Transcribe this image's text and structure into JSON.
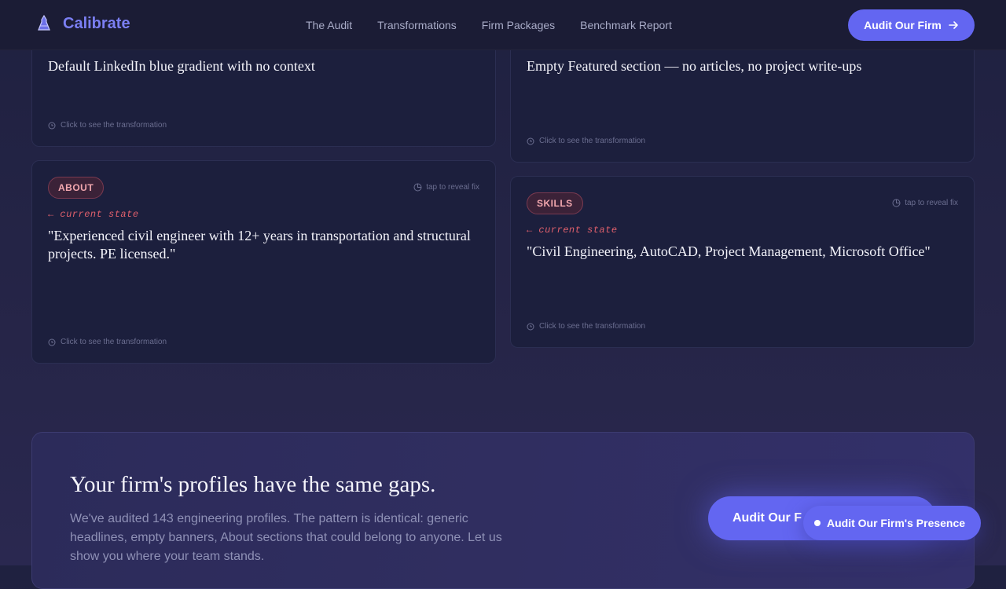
{
  "nav": {
    "brand": "Calibrate",
    "links": [
      "The Audit",
      "Transformations",
      "Firm Packages",
      "Benchmark Report"
    ],
    "cta_label": "Audit Our Firm"
  },
  "cards": {
    "banner": {
      "text": "Default LinkedIn blue gradient with no context",
      "hint": "Click to see the transformation"
    },
    "featured": {
      "text": "Empty Featured section — no articles, no project write-ups",
      "hint": "Click to see the transformation"
    },
    "about": {
      "badge": "ABOUT",
      "tap": "tap to reveal fix",
      "state": "← current state",
      "text": "\"Experienced civil engineer with 12+ years in transportation and structural projects. PE licensed.\"",
      "hint": "Click to see the transformation"
    },
    "skills": {
      "badge": "SKILLS",
      "tap": "tap to reveal fix",
      "state": "← current state",
      "text": "\"Civil Engineering, AutoCAD, Project Management, Microsoft Office\"",
      "hint": "Click to see the transformation"
    }
  },
  "cta": {
    "heading": "Your firm's profiles have the same gaps.",
    "body": "We've audited 143 engineering profiles. The pattern is identical: generic headlines, empty banners, About sections that could belong to anyone. Let us show you where your team stands.",
    "button_label": "Audit Our F"
  },
  "floating": {
    "label": "Audit Our Firm's Presence"
  },
  "colors": {
    "accent": "#6366f1",
    "badge_text": "#f2a7ae",
    "state_text": "#e0606c"
  }
}
